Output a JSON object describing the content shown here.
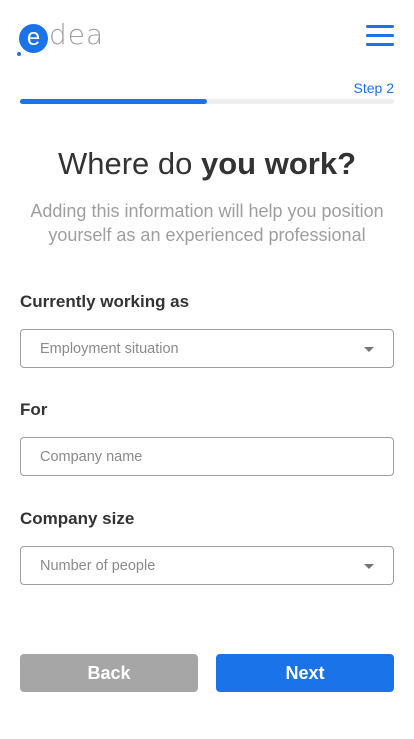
{
  "logo": {
    "mark": "e",
    "rest": "dea"
  },
  "header": {
    "menu_icon": "hamburger-menu-icon"
  },
  "progress": {
    "step_label": "Step 2",
    "fraction": 0.5
  },
  "heading": {
    "title_light": "Where do ",
    "title_bold": "you work?",
    "subtitle": "Adding this information will help you position yourself as an experienced professional"
  },
  "form": {
    "employment": {
      "label": "Currently working as",
      "placeholder": "Employment situation"
    },
    "company": {
      "label": "For",
      "placeholder": "Company name"
    },
    "size": {
      "label": "Company size",
      "placeholder": "Number of people"
    }
  },
  "actions": {
    "back_label": "Back",
    "next_label": "Next"
  },
  "colors": {
    "accent": "#1a73e8",
    "muted_button": "#a6a6a6",
    "track": "#eeeeee"
  }
}
